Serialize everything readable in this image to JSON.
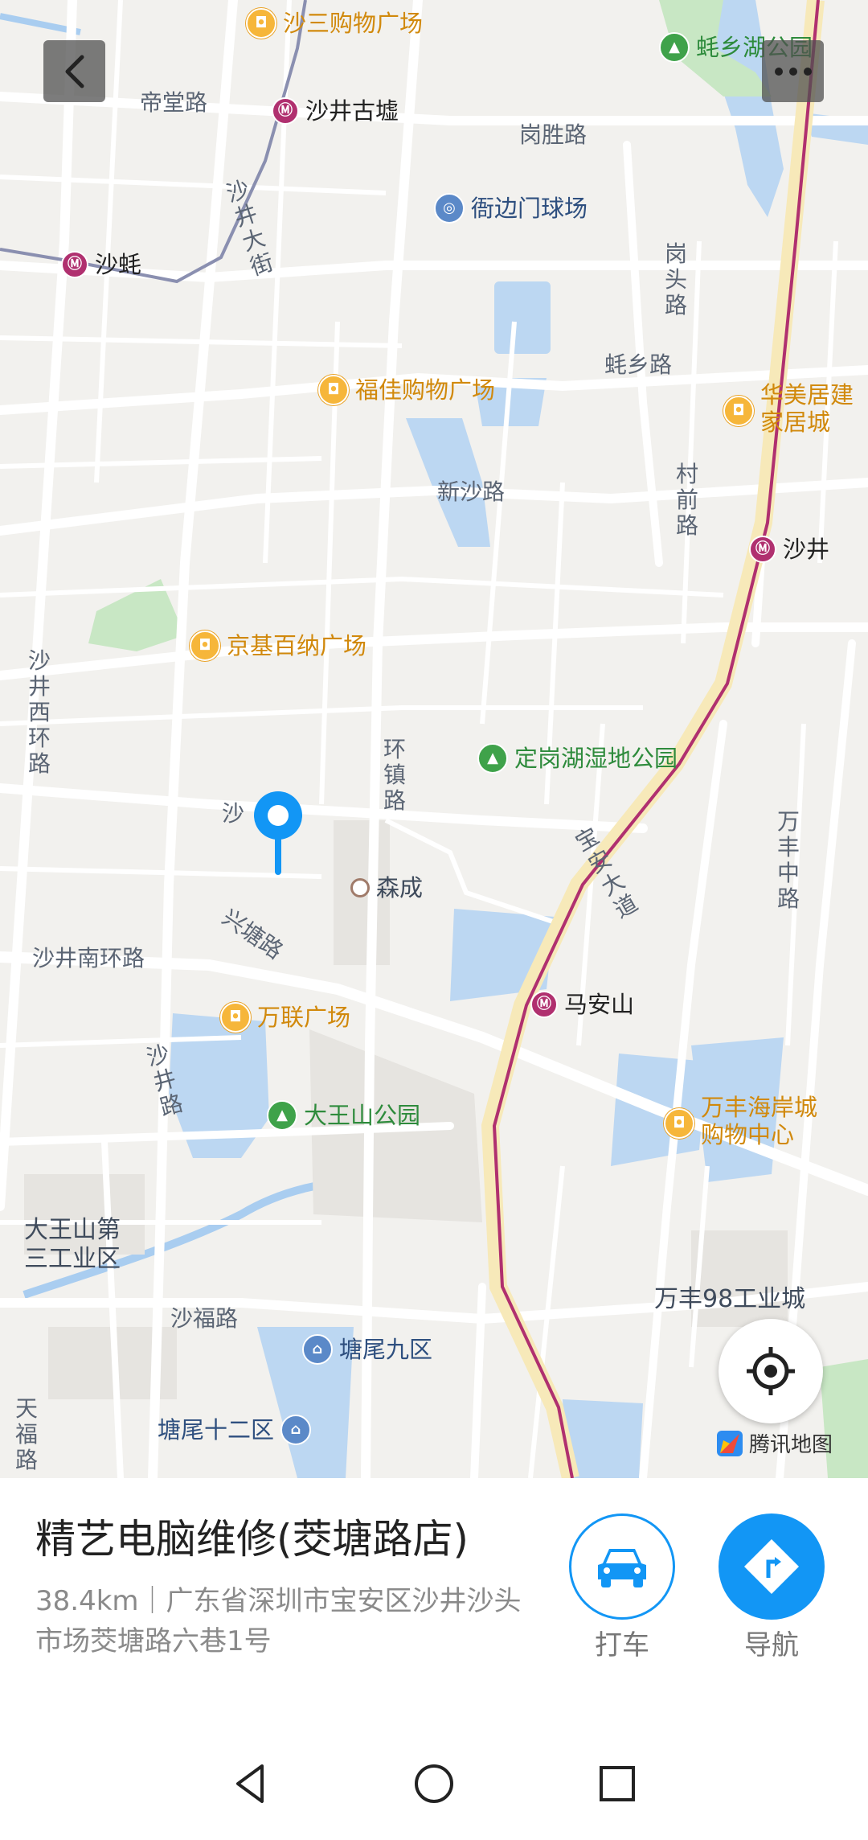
{
  "map": {
    "pois": [
      {
        "label": "沙三购物广场",
        "kind": "shop",
        "icon": "shopping-icon"
      },
      {
        "label": "蚝乡湖公园",
        "kind": "park",
        "icon": "park-tree-icon"
      },
      {
        "label": "沙井古墟",
        "kind": "subway",
        "icon": "metro-icon"
      },
      {
        "label": "沙蚝",
        "kind": "subway",
        "icon": "metro-icon"
      },
      {
        "label": "衙边门球场",
        "kind": "venue",
        "icon": "stadium-icon"
      },
      {
        "label": "福佳购物广场",
        "kind": "shop",
        "icon": "shopping-icon"
      },
      {
        "label": "华美居建\n家居城",
        "kind": "shop",
        "icon": "shopping-icon"
      },
      {
        "label": "沙井",
        "kind": "subway",
        "icon": "metro-icon"
      },
      {
        "label": "京基百纳广场",
        "kind": "shop",
        "icon": "shopping-icon"
      },
      {
        "label": "定岗湖湿地公园",
        "kind": "park",
        "icon": "park-tree-icon"
      },
      {
        "label": "森成",
        "kind": "place",
        "icon": "dot-icon"
      },
      {
        "label": "马安山",
        "kind": "subway",
        "icon": "metro-icon"
      },
      {
        "label": "万联广场",
        "kind": "shop",
        "icon": "shopping-icon"
      },
      {
        "label": "大王山公园",
        "kind": "park",
        "icon": "park-tree-icon"
      },
      {
        "label": "万丰海岸城\n购物中心",
        "kind": "shop",
        "icon": "shopping-icon"
      },
      {
        "label": "塘尾九区",
        "kind": "residential",
        "icon": "house-icon"
      },
      {
        "label": "塘尾十二区",
        "kind": "residential",
        "icon": "house-icon"
      }
    ],
    "areas": [
      "大王山第\n三工业区",
      "万丰98工业城"
    ],
    "roads": [
      "帝堂路",
      "岗胜路",
      "蚝乡路",
      "新沙路",
      "沙井南环路",
      "兴塘路",
      "沙福路",
      "沙"
    ],
    "vertical_roads": [
      "沙井大街",
      "岗头路",
      "村前路",
      "沙井西环路",
      "环镇路",
      "宝安大道",
      "万丰中路",
      "沙井路",
      "天福路"
    ],
    "attribution": "腾讯地图",
    "accent_color": "#1296f5",
    "metro_line_color": "#b0306f"
  },
  "panel": {
    "title": "精艺电脑维修(茭塘路店)",
    "address": "38.4km｜广东省深圳市宝安区沙井沙头市场茭塘路六巷1号",
    "actions": [
      {
        "label": "打车",
        "icon": "car-icon"
      },
      {
        "label": "导航",
        "icon": "navigation-icon"
      }
    ]
  },
  "navbar": {
    "keys": [
      "back-icon",
      "home-icon",
      "recents-icon"
    ]
  }
}
